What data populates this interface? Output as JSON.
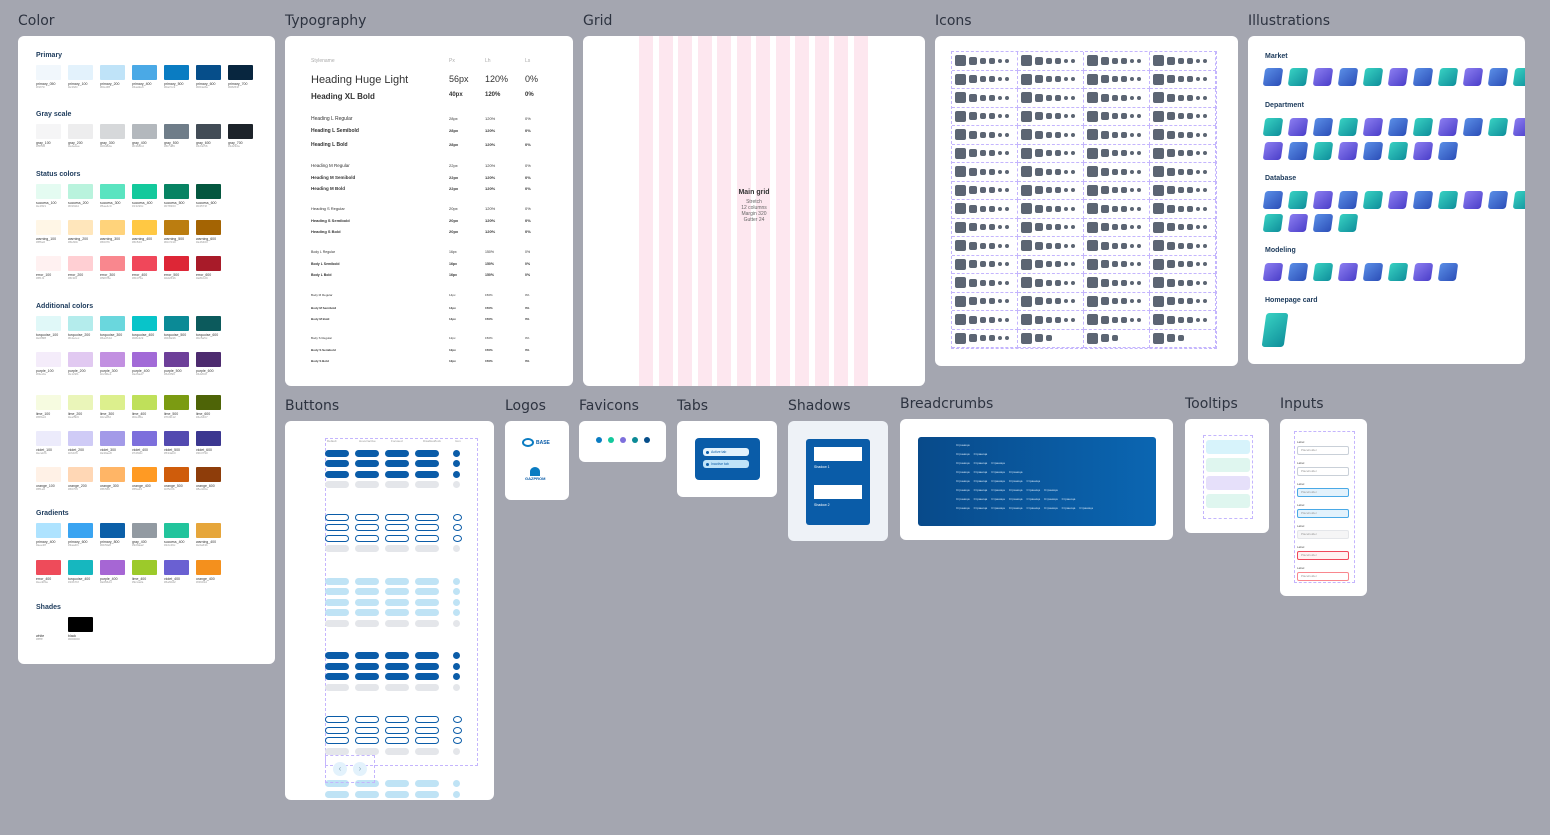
{
  "sections": {
    "color": "Color",
    "typography": "Typography",
    "grid": "Grid",
    "icons": "Icons",
    "illustrations": "Illustrations",
    "buttons": "Buttons",
    "logos": "Logos",
    "favicons": "Favicons",
    "tabs": "Tabs",
    "shadows": "Shadows",
    "breadcrumbs": "Breadcrumbs",
    "tooltips": "Tooltips",
    "inputs": "Inputs"
  },
  "color": {
    "groups": [
      {
        "title": "Primary",
        "swatches": [
          {
            "name": "primary_050",
            "hex": "#f1f7fc"
          },
          {
            "name": "primary_100",
            "hex": "#e3f2fc"
          },
          {
            "name": "primary_200",
            "hex": "#bfe3f8"
          },
          {
            "name": "primary_400",
            "hex": "#4aa9e6"
          },
          {
            "name": "primary_500",
            "hex": "#0a7cc2"
          },
          {
            "name": "primary_600",
            "hex": "#064e8a"
          },
          {
            "name": "primary_700",
            "hex": "#08263f"
          }
        ]
      },
      {
        "title": "Gray scale",
        "swatches": [
          {
            "name": "gray_100",
            "hex": "#f5f5f6"
          },
          {
            "name": "gray_200",
            "hex": "#ededee"
          },
          {
            "name": "gray_300",
            "hex": "#d6d8da"
          },
          {
            "name": "gray_400",
            "hex": "#b3b8bd"
          },
          {
            "name": "gray_500",
            "hex": "#6f7d89"
          },
          {
            "name": "gray_600",
            "hex": "#424c56"
          },
          {
            "name": "gray_700",
            "hex": "#1d232a"
          }
        ]
      },
      {
        "title": "Status colors",
        "swatches": [
          {
            "name": "success_100",
            "hex": "#e4fbf1"
          },
          {
            "name": "success_200",
            "hex": "#b9f3dd"
          },
          {
            "name": "success_300",
            "hex": "#5ae4c0"
          },
          {
            "name": "success_400",
            "hex": "#13c99c"
          },
          {
            "name": "success_500",
            "hex": "#078363"
          },
          {
            "name": "success_600",
            "hex": "#04573f"
          }
        ]
      },
      {
        "title": "",
        "swatches": [
          {
            "name": "warning_100",
            "hex": "#fff6e6"
          },
          {
            "name": "warning_200",
            "hex": "#ffe6bb"
          },
          {
            "name": "warning_300",
            "hex": "#ffd37b"
          },
          {
            "name": "warning_400",
            "hex": "#ffc843"
          },
          {
            "name": "warning_500",
            "hex": "#bb7d10"
          },
          {
            "name": "warning_600",
            "hex": "#a46403"
          }
        ]
      },
      {
        "title": "",
        "swatches": [
          {
            "name": "error_100",
            "hex": "#fff1f1"
          },
          {
            "name": "error_200",
            "hex": "#ffcfd3"
          },
          {
            "name": "error_300",
            "hex": "#f9878e"
          },
          {
            "name": "error_400",
            "hex": "#f0475a"
          },
          {
            "name": "error_500",
            "hex": "#dd2636"
          },
          {
            "name": "error_600",
            "hex": "#a81b29"
          }
        ]
      },
      {
        "title": "Additional colors",
        "swatches": [
          {
            "name": "turquoise_100",
            "hex": "#e0f8f8"
          },
          {
            "name": "turquoise_200",
            "hex": "#b4ecec"
          },
          {
            "name": "turquoise_300",
            "hex": "#6ad7dd"
          },
          {
            "name": "turquoise_400",
            "hex": "#08c4c9"
          },
          {
            "name": "turquoise_500",
            "hex": "#0b8a96"
          },
          {
            "name": "turquoise_600",
            "hex": "#0c5a5c"
          }
        ]
      },
      {
        "title": "",
        "swatches": [
          {
            "name": "purple_100",
            "hex": "#f4ecfa"
          },
          {
            "name": "purple_200",
            "hex": "#e1c9f1"
          },
          {
            "name": "purple_300",
            "hex": "#c290e1"
          },
          {
            "name": "purple_400",
            "hex": "#a26ad7"
          },
          {
            "name": "purple_500",
            "hex": "#6d3f99"
          },
          {
            "name": "purple_600",
            "hex": "#4d2b6f"
          }
        ]
      },
      {
        "title": "",
        "swatches": [
          {
            "name": "lime_100",
            "hex": "#f6fbe0"
          },
          {
            "name": "lime_200",
            "hex": "#eaf5b9"
          },
          {
            "name": "lime_300",
            "hex": "#dcef8d"
          },
          {
            "name": "lime_400",
            "hex": "#bfe05a"
          },
          {
            "name": "lime_500",
            "hex": "#7b9b12"
          },
          {
            "name": "lime_600",
            "hex": "#4e6407"
          }
        ]
      },
      {
        "title": "",
        "swatches": [
          {
            "name": "violet_100",
            "hex": "#ecebfb"
          },
          {
            "name": "violet_200",
            "hex": "#cfcbf6"
          },
          {
            "name": "violet_300",
            "hex": "#a39ae8"
          },
          {
            "name": "violet_400",
            "hex": "#7d6fdc"
          },
          {
            "name": "violet_500",
            "hex": "#534ab0"
          },
          {
            "name": "violet_600",
            "hex": "#3b3790"
          }
        ]
      },
      {
        "title": "",
        "swatches": [
          {
            "name": "orange_100",
            "hex": "#fff1e6"
          },
          {
            "name": "orange_200",
            "hex": "#ffd7b5"
          },
          {
            "name": "orange_300",
            "hex": "#ffb566"
          },
          {
            "name": "orange_400",
            "hex": "#ff9a23"
          },
          {
            "name": "orange_500",
            "hex": "#cf5c0b"
          },
          {
            "name": "orange_600",
            "hex": "#8e3d0a"
          }
        ]
      },
      {
        "title": "Gradients",
        "swatches": [
          {
            "name": "primary_400",
            "hex": "#aee3ff"
          },
          {
            "name": "primary_600",
            "hex": "#3aa4f1"
          },
          {
            "name": "primary_800",
            "hex": "#0b5fa8"
          },
          {
            "name": "gray_400",
            "hex": "#929aa2"
          },
          {
            "name": "success_400",
            "hex": "#22c49c"
          },
          {
            "name": "warning_400",
            "hex": "#e6a63b"
          }
        ]
      },
      {
        "title": "",
        "swatches": [
          {
            "name": "error_400",
            "hex": "#ee4b5a"
          },
          {
            "name": "turquoise_400",
            "hex": "#16b7bf"
          },
          {
            "name": "purple_400",
            "hex": "#a666d4"
          },
          {
            "name": "lime_400",
            "hex": "#9cca2a"
          },
          {
            "name": "violet_400",
            "hex": "#6a60d2"
          },
          {
            "name": "orange_400",
            "hex": "#f4901d"
          }
        ]
      },
      {
        "title": "Shades",
        "swatches": [
          {
            "name": "white",
            "hex": "#ffffff"
          },
          {
            "name": "black",
            "hex": "#000000"
          }
        ]
      }
    ]
  },
  "typography": {
    "header": {
      "name": "Stylename",
      "size": "Px",
      "lh": "Lh",
      "ls": "Ls"
    },
    "rows": [
      {
        "name": "Heading Huge Light",
        "size": "56px",
        "lh": "120%",
        "ls": "0%"
      },
      {
        "name": "Heading XL Bold",
        "size": "40px",
        "lh": "120%",
        "ls": "0%"
      },
      {
        "name": "Heading L Regular",
        "size": "28px",
        "lh": "120%",
        "ls": "0%"
      },
      {
        "name": "Heading L Semibold",
        "size": "28px",
        "lh": "120%",
        "ls": "0%"
      },
      {
        "name": "Heading L Bold",
        "size": "28px",
        "lh": "120%",
        "ls": "0%"
      },
      {
        "name": "Heading M Regular",
        "size": "22px",
        "lh": "120%",
        "ls": "0%"
      },
      {
        "name": "Heading M Semibold",
        "size": "22px",
        "lh": "120%",
        "ls": "0%"
      },
      {
        "name": "Heading M Bold",
        "size": "22px",
        "lh": "120%",
        "ls": "0%"
      },
      {
        "name": "Heading S Regular",
        "size": "20px",
        "lh": "120%",
        "ls": "0%"
      },
      {
        "name": "Heading S Semibold",
        "size": "20px",
        "lh": "120%",
        "ls": "0%"
      },
      {
        "name": "Heading S Bold",
        "size": "20px",
        "lh": "120%",
        "ls": "0%"
      },
      {
        "name": "Body L Regular",
        "size": "16px",
        "lh": "150%",
        "ls": "0%"
      },
      {
        "name": "Body L Semibold",
        "size": "16px",
        "lh": "150%",
        "ls": "0%"
      },
      {
        "name": "Body L Bold",
        "size": "16px",
        "lh": "150%",
        "ls": "0%"
      },
      {
        "name": "Body M Regular",
        "size": "14px",
        "lh": "150%",
        "ls": "0%"
      },
      {
        "name": "Body M Semibold",
        "size": "14px",
        "lh": "150%",
        "ls": "0%"
      },
      {
        "name": "Body M Bold",
        "size": "14px",
        "lh": "150%",
        "ls": "0%"
      },
      {
        "name": "Body S Regular",
        "size": "12px",
        "lh": "150%",
        "ls": "0%"
      },
      {
        "name": "Body S Semibold",
        "size": "12px",
        "lh": "150%",
        "ls": "0%"
      },
      {
        "name": "Body S Bold",
        "size": "12px",
        "lh": "150%",
        "ls": "0%"
      }
    ]
  },
  "grid": {
    "title": "Main grid",
    "lines": [
      "Stretch",
      "12 columns",
      "Margin 320",
      "Gutter 24"
    ]
  },
  "illustrations": {
    "groups": [
      {
        "title": "Market",
        "count": 11
      },
      {
        "title": "Department",
        "count": 11
      },
      {
        "title": "",
        "count": 8
      },
      {
        "title": "Database",
        "count": 11
      },
      {
        "title": "",
        "count": 4
      },
      {
        "title": "Modeling",
        "count": 8
      },
      {
        "title": "Homepage card",
        "count": 1
      }
    ]
  },
  "buttons": {
    "header": [
      "Default",
      "Hover/active",
      "Focused",
      "Disabled/lock",
      "Icon"
    ],
    "label": "Button"
  },
  "logos": {
    "items": [
      "BASE",
      "GAZPROM"
    ]
  },
  "favicons": {
    "colors": [
      "#0a7cc2",
      "#13c99c",
      "#7d6fdc",
      "#0b8a96",
      "#064e8a"
    ]
  },
  "tabs": {
    "items": [
      "Active tab",
      "Inactive tab"
    ]
  },
  "shadows": {
    "items": [
      "Shadow 1",
      "Shadow 2"
    ]
  },
  "breadcrumbs": {
    "rows": 8,
    "label": "Страница"
  },
  "tooltips": {
    "count": 4
  },
  "inputs": {
    "label": "Label",
    "placeholder": "Placeholder",
    "count": 7
  }
}
